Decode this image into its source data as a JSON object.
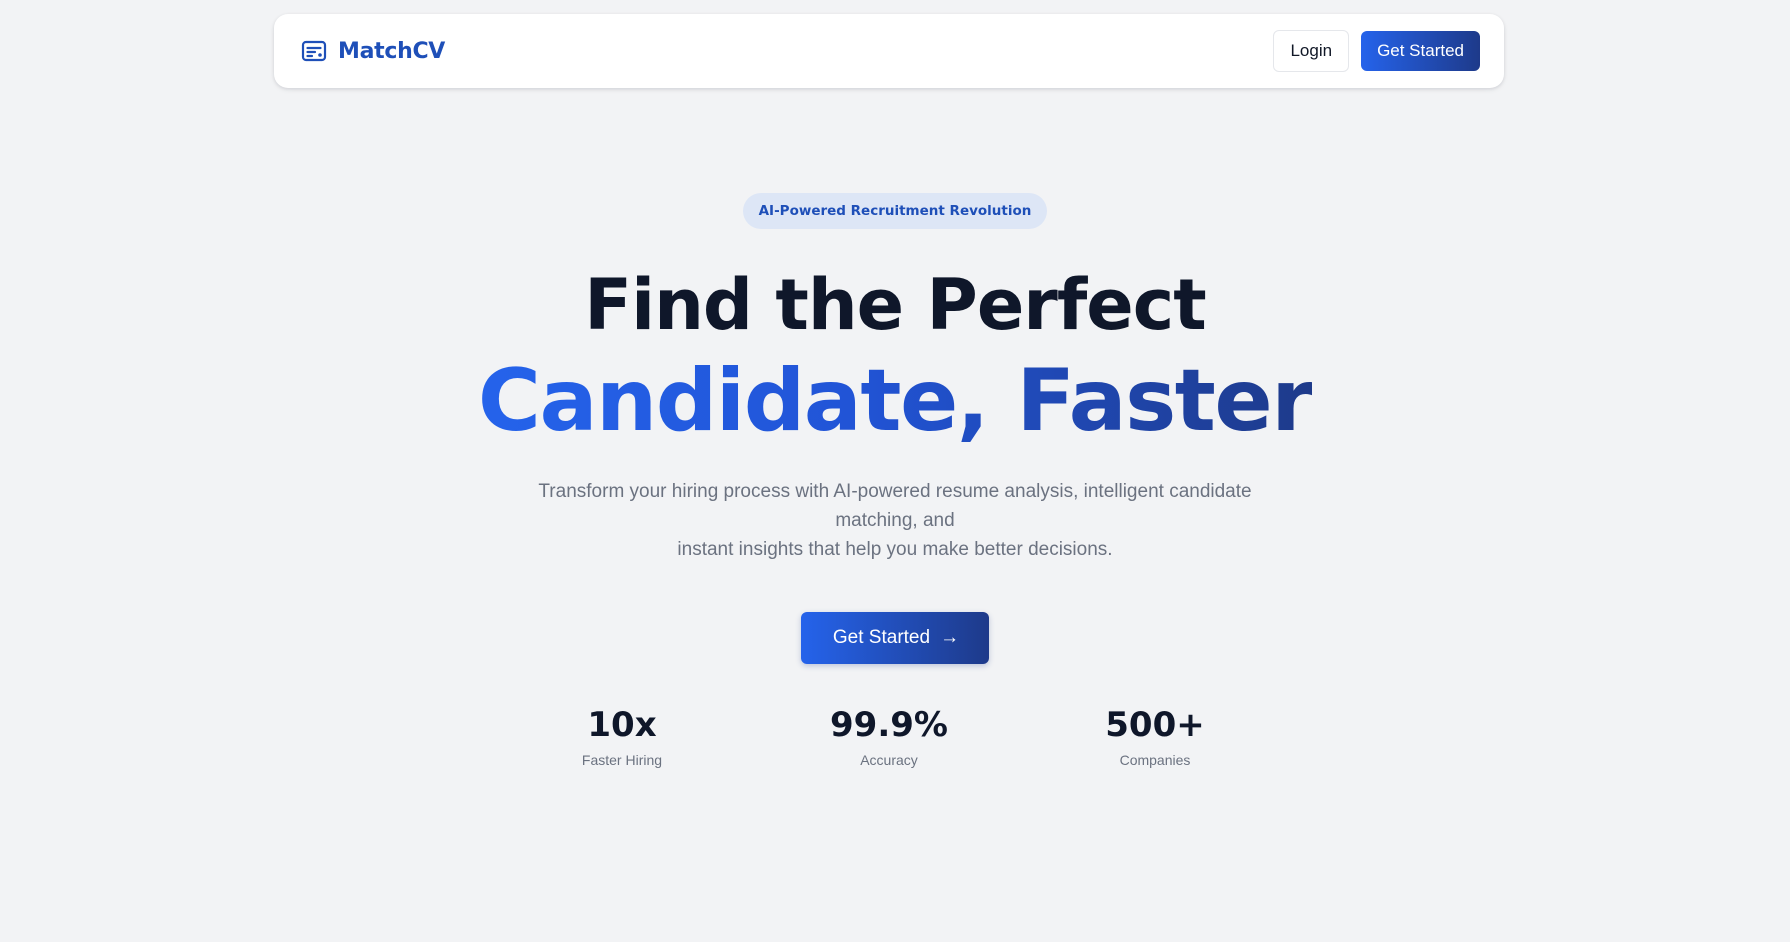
{
  "colors": {
    "background": "#f2f3f5",
    "brand": "#1e4fb8",
    "accent_start": "#2563eb",
    "accent_end": "#1e3a8a",
    "heading": "#0f172a",
    "muted": "#6b7280"
  },
  "navbar": {
    "brand_icon": "resume-card-icon",
    "brand_name": "MatchCV",
    "login_label": "Login",
    "get_started_label": "Get Started"
  },
  "hero": {
    "badge": "AI-Powered Recruitment Revolution",
    "headline_line1": "Find the Perfect",
    "headline_line2": "Candidate, Faster",
    "subtitle_line1": "Transform your hiring process with AI-powered resume analysis, intelligent candidate matching, and",
    "subtitle_line2": "instant insights that help you make better decisions.",
    "cta_label": "Get Started",
    "cta_arrow": "→"
  },
  "stats": [
    {
      "value": "10x",
      "label": "Faster Hiring"
    },
    {
      "value": "99.9%",
      "label": "Accuracy"
    },
    {
      "value": "500+",
      "label": "Companies"
    }
  ]
}
